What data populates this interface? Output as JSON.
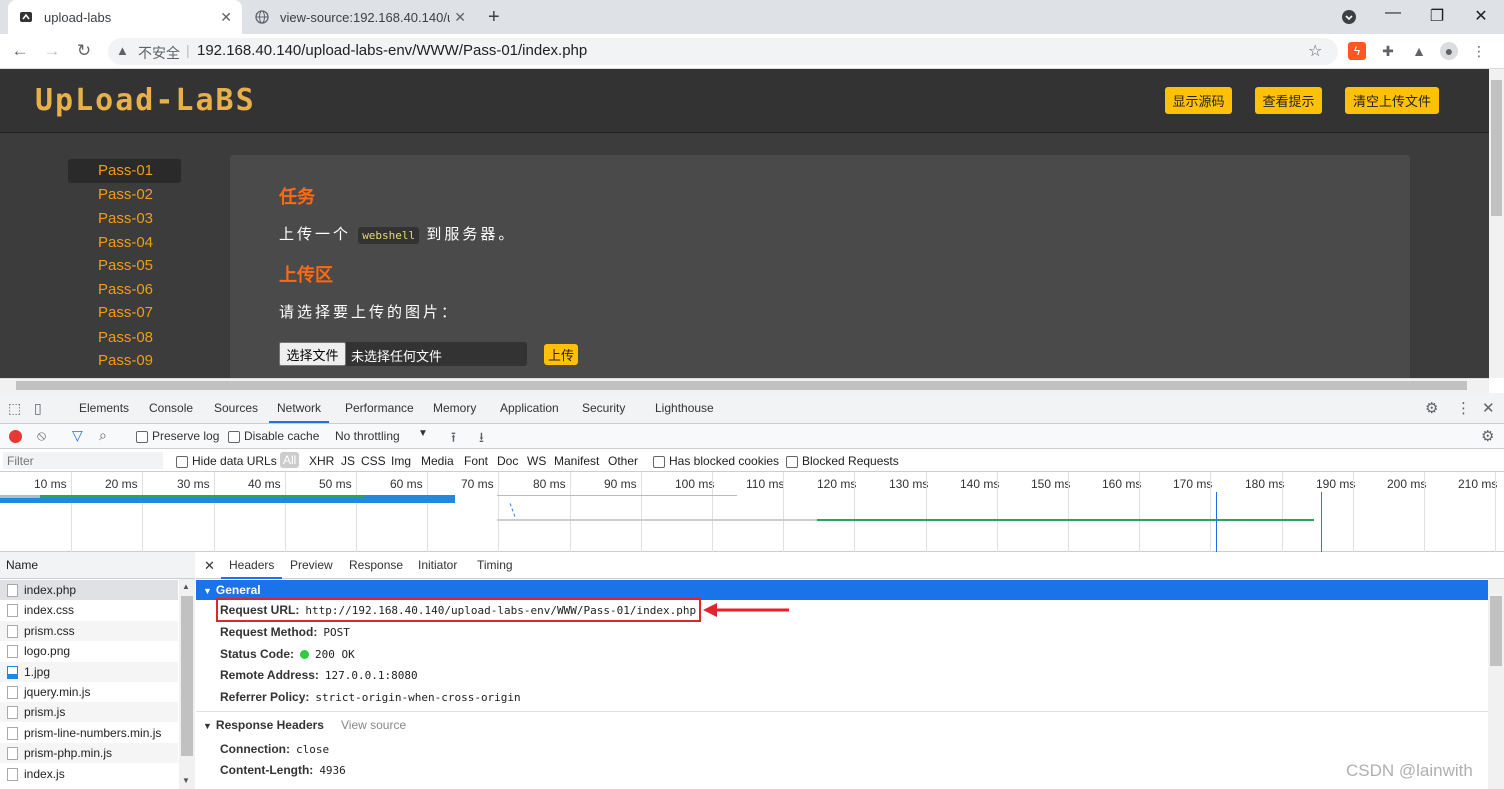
{
  "browser": {
    "tabs": [
      {
        "title": "upload-labs",
        "active": true
      },
      {
        "title": "view-source:192.168.40.140/u",
        "active": false
      }
    ],
    "new_tab": "+",
    "security_label": "不安全",
    "url": "192.168.40.140/upload-labs-env/WWW/Pass-01/index.php"
  },
  "page": {
    "logo": "UpLoad-LaBS",
    "header_buttons": [
      "显示源码",
      "查看提示",
      "清空上传文件"
    ],
    "passes": [
      "Pass-01",
      "Pass-02",
      "Pass-03",
      "Pass-04",
      "Pass-05",
      "Pass-06",
      "Pass-07",
      "Pass-08",
      "Pass-09"
    ],
    "selected_pass": "Pass-01",
    "task_heading": "任务",
    "task_pre": "上传一个",
    "task_code": "webshell",
    "task_post": "到服务器。",
    "upload_heading": "上传区",
    "upload_prompt": "请选择要上传的图片：",
    "choose_file": "选择文件",
    "no_file": "未选择任何文件",
    "upload_button": "上传"
  },
  "devtools": {
    "tabs": [
      "Elements",
      "Console",
      "Sources",
      "Network",
      "Performance",
      "Memory",
      "Application",
      "Security",
      "Lighthouse"
    ],
    "active_tab": "Network",
    "preserve_log": "Preserve log",
    "disable_cache": "Disable cache",
    "throttling": "No throttling",
    "filter_placeholder": "Filter",
    "hide_data_urls": "Hide data URLs",
    "type_filters": [
      "All",
      "XHR",
      "JS",
      "CSS",
      "Img",
      "Media",
      "Font",
      "Doc",
      "WS",
      "Manifest",
      "Other"
    ],
    "has_blocked_cookies": "Has blocked cookies",
    "blocked_requests": "Blocked Requests",
    "timeline_ticks": [
      "10 ms",
      "20 ms",
      "30 ms",
      "40 ms",
      "50 ms",
      "60 ms",
      "70 ms",
      "80 ms",
      "90 ms",
      "100 ms",
      "110 ms",
      "120 ms",
      "130 ms",
      "140 ms",
      "150 ms",
      "160 ms",
      "170 ms",
      "180 ms",
      "190 ms",
      "200 ms",
      "210 ms"
    ],
    "name_header": "Name",
    "requests": [
      "index.php",
      "index.css",
      "prism.css",
      "logo.png",
      "1.jpg",
      "jquery.min.js",
      "prism.js",
      "prism-line-numbers.min.js",
      "prism-php.min.js",
      "index.js"
    ],
    "detail_tabs": [
      "Headers",
      "Preview",
      "Response",
      "Initiator",
      "Timing"
    ],
    "active_detail_tab": "Headers",
    "general_title": "General",
    "general": [
      {
        "key": "Request URL:",
        "value": "http://192.168.40.140/upload-labs-env/WWW/Pass-01/index.php"
      },
      {
        "key": "Request Method:",
        "value": "POST"
      },
      {
        "key": "Status Code:",
        "value": "200 OK"
      },
      {
        "key": "Remote Address:",
        "value": "127.0.0.1:8080"
      },
      {
        "key": "Referrer Policy:",
        "value": "strict-origin-when-cross-origin"
      }
    ],
    "response_headers_title": "Response Headers",
    "view_source": "View source",
    "response_headers": [
      {
        "key": "Connection:",
        "value": "close"
      },
      {
        "key": "Content-Length:",
        "value": "4936"
      }
    ]
  },
  "watermark": "CSDN @lainwith",
  "colors": {
    "accent": "#ffc107",
    "pass_link": "#f39c12",
    "heading": "#ff6a13",
    "devtools_blue": "#1a73e8",
    "annotation_red": "#e0242b"
  }
}
